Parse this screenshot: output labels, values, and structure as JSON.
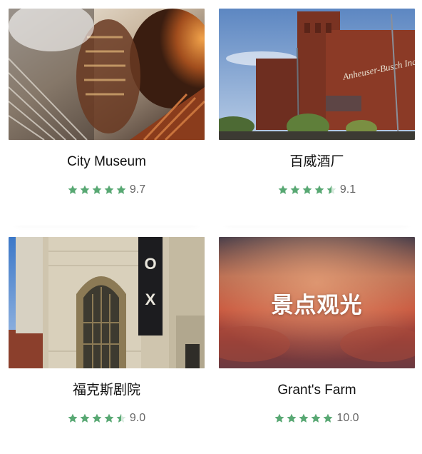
{
  "colors": {
    "star_green": "#58a873",
    "star_empty": "#d6e9dc",
    "title_text": "#111111",
    "score_text": "#666666"
  },
  "attractions": [
    {
      "name": "City Museum",
      "score": "9.7",
      "stars": 5,
      "image": "industrial-sculpture-photo"
    },
    {
      "name": "百威酒厂",
      "score": "9.1",
      "stars": 4.5,
      "image": "brewery-building-photo"
    },
    {
      "name": "福克斯剧院",
      "score": "9.0",
      "stars": 4.5,
      "image": "theater-facade-photo"
    },
    {
      "name": "Grant's Farm",
      "score": "10.0",
      "stars": 5,
      "image": "blurred-placeholder-photo",
      "overlay": "景点观光"
    }
  ]
}
